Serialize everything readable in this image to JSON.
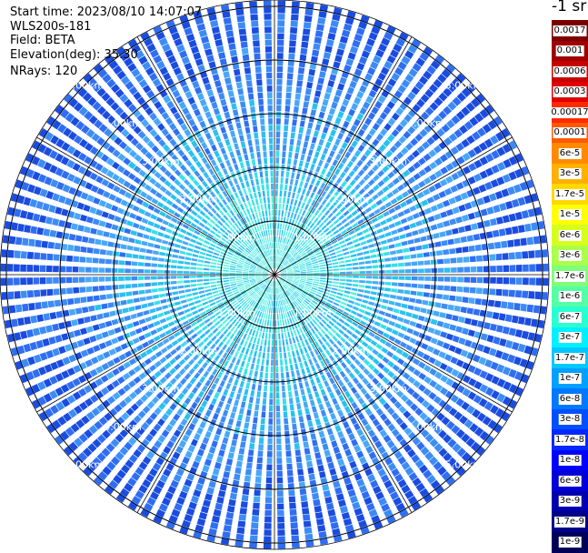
{
  "header": {
    "start_time": "Start time: 2023/08/10 14:07:07",
    "device": "WLS200s-181",
    "field": "Field: BETA",
    "elevation": "Elevation(deg): 35.30",
    "nrays": "NRays: 120"
  },
  "units_label": "-1 sr",
  "range_rings": [
    "1.00km",
    "2.00km",
    "3.00km",
    "4.00km",
    "5.00km"
  ],
  "colorbar": {
    "labels": [
      "0.0017",
      "0.001",
      "0.0006",
      "0.0003",
      "0.00017",
      "0.0001",
      "6e-5",
      "3e-5",
      "1.7e-5",
      "1e-5",
      "6e-6",
      "3e-6",
      "1.7e-6",
      "1e-6",
      "6e-7",
      "3e-7",
      "1.7e-7",
      "1e-7",
      "6e-8",
      "3e-8",
      "1.7e-8",
      "1e-8",
      "6e-9",
      "3e-9",
      "1.7e-9",
      "1e-9"
    ],
    "colors": [
      "#7a0000",
      "#a00000",
      "#c80000",
      "#e00000",
      "#ff2a00",
      "#ff5a00",
      "#ff8a00",
      "#ffb000",
      "#ffd800",
      "#ffff00",
      "#d6ff1e",
      "#aaff4c",
      "#7fff7a",
      "#55ffa4",
      "#2affd2",
      "#00f0ff",
      "#00c8ff",
      "#00a0ff",
      "#0078ff",
      "#0050ff",
      "#0028ff",
      "#0000ff",
      "#0000d8",
      "#0000b0",
      "#000088",
      "#00005a"
    ]
  },
  "ppi_palette": [
    "#1a4ce0",
    "#2f6ef2",
    "#3c8cf5",
    "#47a8f8",
    "#29c2ee",
    "#36e0e8",
    "#58f2de"
  ]
}
